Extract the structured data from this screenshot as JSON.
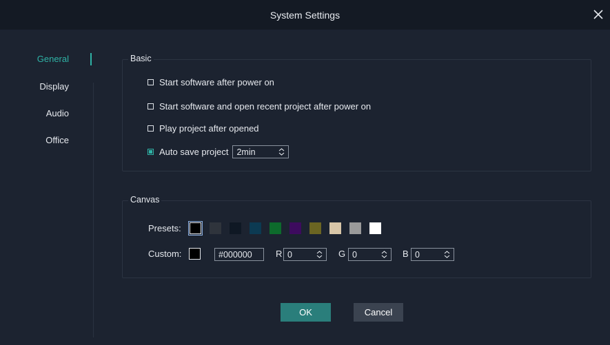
{
  "window": {
    "title": "System Settings"
  },
  "sidebar": {
    "items": [
      {
        "label": "General",
        "active": true
      },
      {
        "label": "Display",
        "active": false
      },
      {
        "label": "Audio",
        "active": false
      },
      {
        "label": "Office",
        "active": false
      }
    ]
  },
  "basic": {
    "title": "Basic",
    "options": [
      {
        "label": "Start software after power on",
        "checked": false
      },
      {
        "label": "Start software and open recent project after power on",
        "checked": false
      },
      {
        "label": "Play project after opened",
        "checked": false
      },
      {
        "label": "Auto save project",
        "checked": true
      }
    ],
    "autosave_interval": "2min"
  },
  "canvas": {
    "title": "Canvas",
    "presets_label": "Presets:",
    "presets": [
      "#000000",
      "#2f343c",
      "#0f1824",
      "#0c3a52",
      "#0d6b2c",
      "#3d0b5e",
      "#6b6522",
      "#d8c6a8",
      "#9a9a9a",
      "#ffffff"
    ],
    "custom_label": "Custom:",
    "custom_color": "#000000",
    "hex_value": "#000000",
    "r_label": "R",
    "r_value": "0",
    "g_label": "G",
    "g_value": "0",
    "b_label": "B",
    "b_value": "0"
  },
  "buttons": {
    "ok": "OK",
    "cancel": "Cancel"
  },
  "colors": {
    "accent": "#2fb3a6",
    "background": "#1c2330",
    "titlebar": "#141a24"
  }
}
